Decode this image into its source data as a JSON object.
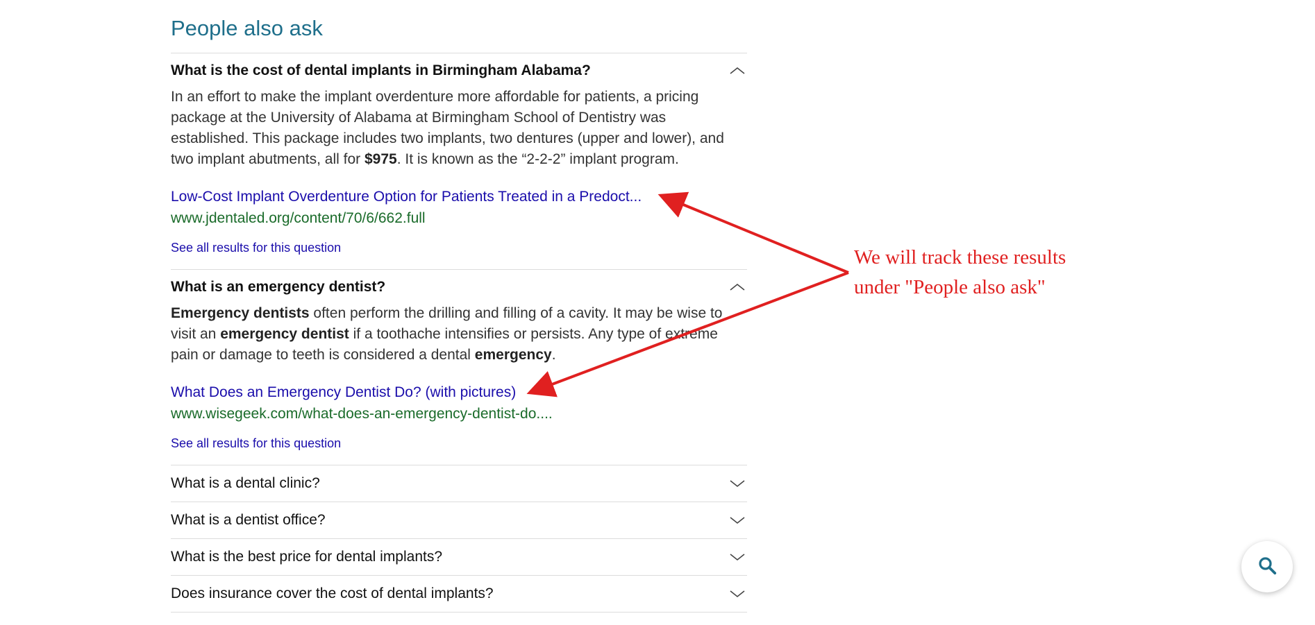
{
  "section_title": "People also ask",
  "questions": [
    {
      "question": "What is the cost of dental implants in Birmingham Alabama?",
      "expanded": true,
      "answer_parts": [
        {
          "t": "In an effort to make the implant overdenture more affordable for patients, a pricing package at the University of Alabama at Birmingham School of Dentistry was established. This package includes two implants, two dentures (upper and lower), and two implant abutments, all for "
        },
        {
          "t": "$975",
          "bold": true
        },
        {
          "t": ". It is known as the “2-2-2” implant program."
        }
      ],
      "result_title": "Low-Cost Implant Overdenture Option for Patients Treated in a Predoct...",
      "result_url": "www.jdentaled.org/content/70/6/662.full",
      "see_all": "See all results for this question"
    },
    {
      "question": "What is an emergency dentist?",
      "expanded": true,
      "answer_parts": [
        {
          "t": "Emergency dentists",
          "bold": true
        },
        {
          "t": " often perform the drilling and filling of a cavity. It may be wise to visit an "
        },
        {
          "t": "emergency dentist",
          "bold": true
        },
        {
          "t": " if a toothache intensifies or persists. Any type of extreme pain or damage to teeth is considered a dental "
        },
        {
          "t": "emergency",
          "bold": true
        },
        {
          "t": "."
        }
      ],
      "result_title": "What Does an Emergency Dentist Do? (with pictures)",
      "result_url": "www.wisegeek.com/what-does-an-emergency-dentist-do....",
      "see_all": "See all results for this question"
    },
    {
      "question": "What is a dental clinic?",
      "expanded": false
    },
    {
      "question": "What is a dentist office?",
      "expanded": false
    },
    {
      "question": "What is the best price for dental implants?",
      "expanded": false
    },
    {
      "question": "Does insurance cover the cost of dental implants?",
      "expanded": false
    }
  ],
  "annotation": {
    "line1": "We will track these results",
    "line2": "under \"People also ask\"",
    "color": "#e02020"
  },
  "icons": {
    "expanded": "chevron-up-icon",
    "collapsed": "chevron-down-icon",
    "fab": "search-icon"
  },
  "colors": {
    "title": "#1f6f8b",
    "link": "#1a0dab",
    "url": "#1a6b2a"
  }
}
